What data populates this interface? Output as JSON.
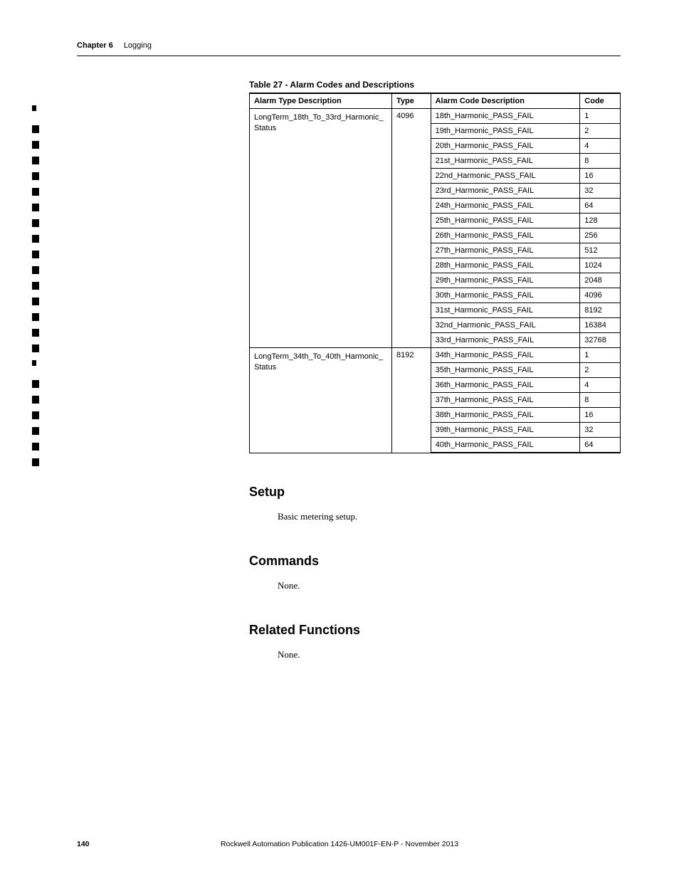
{
  "header": {
    "chapter_label": "Chapter 6",
    "chapter_title": "Logging"
  },
  "table": {
    "caption": "Table 27 - Alarm Codes and Descriptions",
    "headers": {
      "type_desc": "Alarm Type Description",
      "type": "Type",
      "code_desc": "Alarm Code Description",
      "code": "Code"
    },
    "groups": [
      {
        "type_desc": "LongTerm_18th_To_33rd_Harmonic_Status",
        "type": "4096",
        "rows": [
          {
            "desc": "18th_Harmonic_PASS_FAIL",
            "code": "1"
          },
          {
            "desc": "19th_Harmonic_PASS_FAIL",
            "code": "2"
          },
          {
            "desc": "20th_Harmonic_PASS_FAIL",
            "code": "4"
          },
          {
            "desc": "21st_Harmonic_PASS_FAIL",
            "code": "8"
          },
          {
            "desc": "22nd_Harmonic_PASS_FAIL",
            "code": "16"
          },
          {
            "desc": "23rd_Harmonic_PASS_FAIL",
            "code": "32"
          },
          {
            "desc": "24th_Harmonic_PASS_FAIL",
            "code": "64"
          },
          {
            "desc": "25th_Harmonic_PASS_FAIL",
            "code": "128"
          },
          {
            "desc": "26th_Harmonic_PASS_FAIL",
            "code": "256"
          },
          {
            "desc": "27th_Harmonic_PASS_FAIL",
            "code": "512"
          },
          {
            "desc": "28th_Harmonic_PASS_FAIL",
            "code": "1024"
          },
          {
            "desc": "29th_Harmonic_PASS_FAIL",
            "code": "2048"
          },
          {
            "desc": "30th_Harmonic_PASS_FAIL",
            "code": "4096"
          },
          {
            "desc": "31st_Harmonic_PASS_FAIL",
            "code": "8192"
          },
          {
            "desc": "32nd_Harmonic_PASS_FAIL",
            "code": "16384"
          },
          {
            "desc": "33rd_Harmonic_PASS_FAIL",
            "code": "32768"
          }
        ]
      },
      {
        "type_desc": "LongTerm_34th_To_40th_Harmonic_Status",
        "type": "8192",
        "rows": [
          {
            "desc": "34th_Harmonic_PASS_FAIL",
            "code": "1"
          },
          {
            "desc": "35th_Harmonic_PASS_FAIL",
            "code": "2"
          },
          {
            "desc": "36th_Harmonic_PASS_FAIL",
            "code": "4"
          },
          {
            "desc": "37th_Harmonic_PASS_FAIL",
            "code": "8"
          },
          {
            "desc": "38th_Harmonic_PASS_FAIL",
            "code": "16"
          },
          {
            "desc": "39th_Harmonic_PASS_FAIL",
            "code": "32"
          },
          {
            "desc": "40th_Harmonic_PASS_FAIL",
            "code": "64"
          }
        ]
      }
    ]
  },
  "sections": {
    "s1": {
      "heading": "Setup",
      "body": "Basic metering setup."
    },
    "s2": {
      "heading": "Commands",
      "body": "None."
    },
    "s3": {
      "heading": "Related Functions",
      "body": "None."
    }
  },
  "footer": {
    "page": "140",
    "pub": "Rockwell Automation Publication 1426-UM001F-EN-P - November 2013"
  },
  "change_bars": [
    {
      "h": 8
    },
    {
      "h": 11
    },
    {
      "h": 11
    },
    {
      "h": 11
    },
    {
      "h": 11
    },
    {
      "h": 11
    },
    {
      "h": 11
    },
    {
      "h": 11
    },
    {
      "h": 11
    },
    {
      "h": 11
    },
    {
      "h": 11
    },
    {
      "h": 11
    },
    {
      "h": 11
    },
    {
      "h": 11
    },
    {
      "h": 11
    },
    {
      "h": 11
    },
    {
      "h": 8
    },
    {
      "h": 11
    },
    {
      "h": 11
    },
    {
      "h": 11
    },
    {
      "h": 11
    },
    {
      "h": 11
    },
    {
      "h": 11
    }
  ]
}
